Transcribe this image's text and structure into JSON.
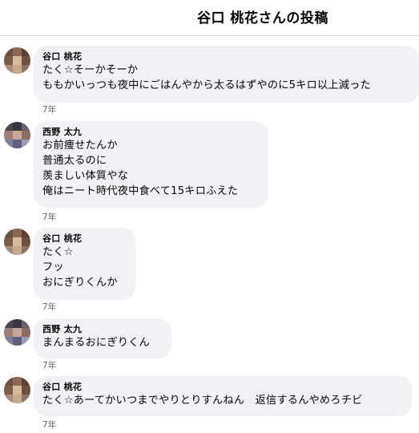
{
  "page": {
    "title": "谷口 桃花さんの投稿"
  },
  "comments": [
    {
      "author": "谷口 桃花",
      "avatar_icon": "blurred-profile-photo-icon",
      "lines": [
        "たく☆そーかそーか",
        "ももかいっつも夜中にごはんやから太るはずやのに5キロ以上減った"
      ],
      "time": "7年"
    },
    {
      "author": "西野 太九",
      "avatar_icon": "blurred-profile-photo-icon",
      "lines": [
        "お前痩せたんか",
        "普通太るのに",
        "羨ましい体質やな",
        "俺はニート時代夜中食べて15キロふえた"
      ],
      "time": "7年"
    },
    {
      "author": "谷口 桃花",
      "avatar_icon": "blurred-profile-photo-icon",
      "lines": [
        "たく☆",
        "フッ",
        "おにぎりくんか"
      ],
      "time": "7年"
    },
    {
      "author": "西野 太九",
      "avatar_icon": "blurred-profile-photo-icon",
      "lines": [
        "まんまるおにぎりくん"
      ],
      "time": "7年"
    },
    {
      "author": "谷口 桃花",
      "avatar_icon": "blurred-profile-photo-icon",
      "lines": [
        "たく☆あーてかいつまでやりとりすんねん　返信するんやめろチビ"
      ],
      "time": "7年"
    }
  ]
}
